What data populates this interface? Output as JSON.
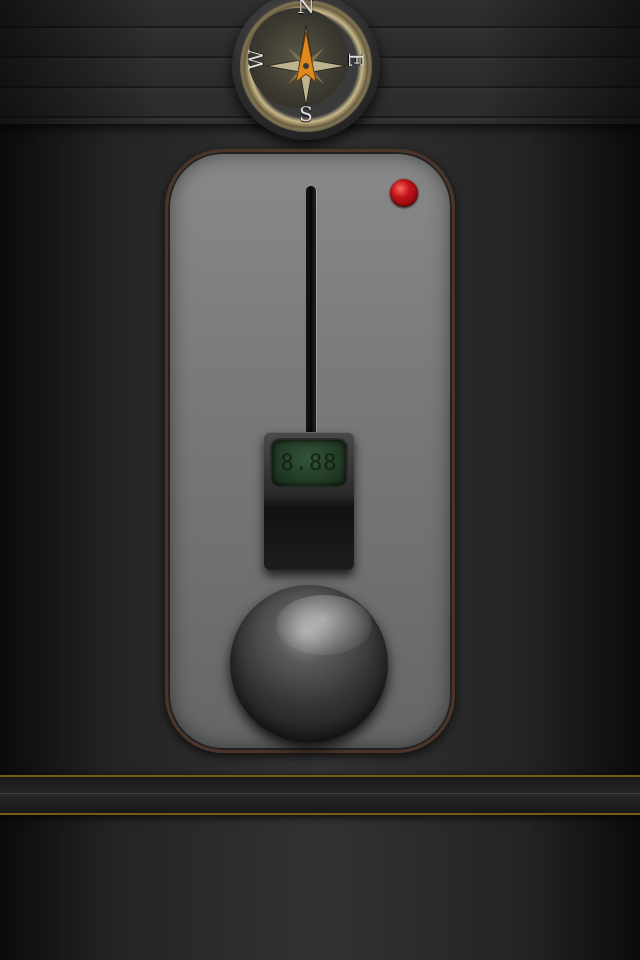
{
  "compass": {
    "north": "N",
    "east": "E",
    "south": "S",
    "west": "W",
    "needle_color": "#e08a1e"
  },
  "panel": {
    "led_color": "#c0141a",
    "lcd_display": "8.88",
    "lcd_color": "#1f3622"
  },
  "colors": {
    "panel_border": "#4a3528",
    "strip_accent": "#7a5a1a"
  }
}
